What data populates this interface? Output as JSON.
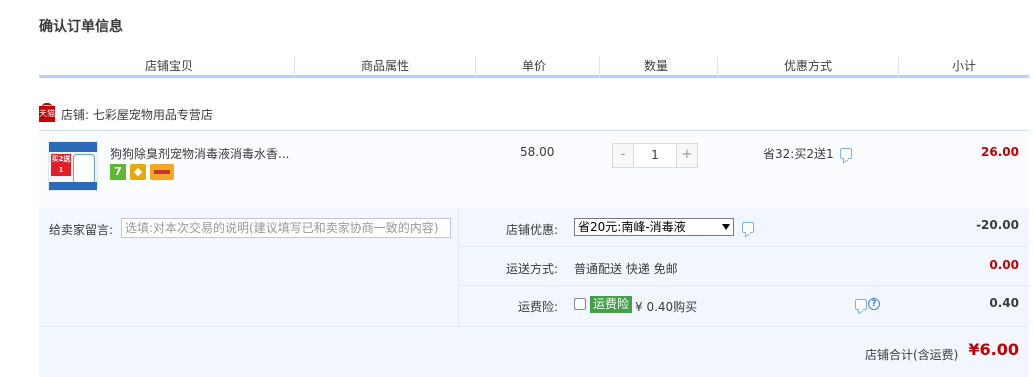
{
  "page": {
    "title": "确认订单信息"
  },
  "table_header": {
    "columns": [
      "店铺宝贝",
      "商品属性",
      "单价",
      "数量",
      "优惠方式",
      "小计"
    ]
  },
  "shop": {
    "badge": "天猫",
    "label": "店铺: 七彩屋宠物用品专营店"
  },
  "item": {
    "thumb_text": "买2送1",
    "title": "狗狗除臭剂宠物消毒液消毒水香...",
    "badge_icons": [
      "seven-day-return-icon",
      "shield-guarantee-icon",
      "credit-card-icon"
    ],
    "price": "58.00",
    "quantity": {
      "minus": "-",
      "value": "1",
      "plus": "+"
    },
    "promotion": "省32:买2送1",
    "subtotal": "26.00"
  },
  "order_options": {
    "message": {
      "label": "给卖家留言:",
      "placeholder": "选填:对本次交易的说明(建议填写已和卖家协商一致的内容)"
    },
    "shop_discount": {
      "label": "店铺优惠:",
      "selected": "省20元:南峰-消毒液",
      "value": "-20.00"
    },
    "shipping": {
      "label": "运送方式:",
      "method": "普通配送 快递 免邮",
      "value": "0.00"
    },
    "shipping_insurance": {
      "label": "运费险:",
      "badge": "运费险",
      "price_text": "¥ 0.40购买",
      "help": "?",
      "value": "0.40"
    }
  },
  "total": {
    "label": "店铺合计(含运费)",
    "amount": "¥6.00"
  },
  "colors": {
    "accent_red": "#c40000",
    "header_line": "#b2d1ff",
    "panel_bg": "#f2f7ff",
    "insurance_green": "#44a048"
  }
}
